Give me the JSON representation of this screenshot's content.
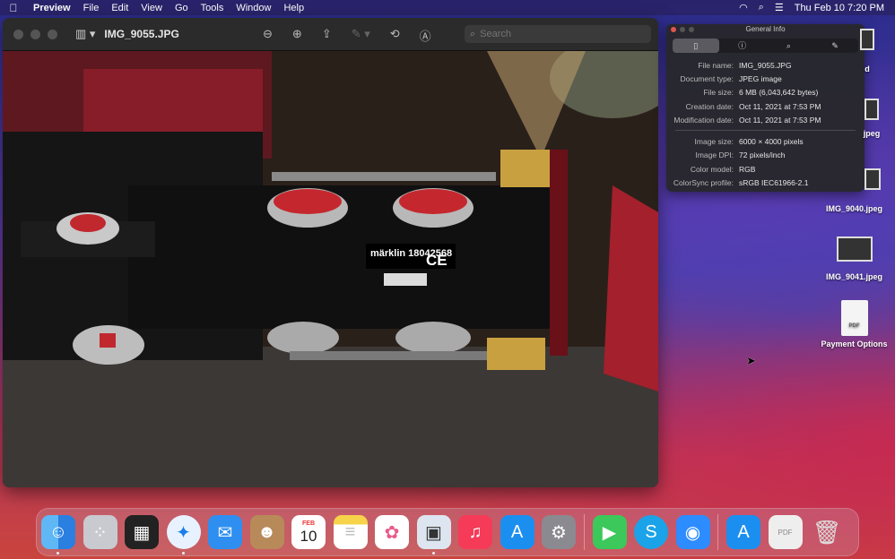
{
  "menubar": {
    "apple": "",
    "app": "Preview",
    "items": [
      "File",
      "Edit",
      "View",
      "Go",
      "Tools",
      "Window",
      "Help"
    ],
    "clock": "Thu Feb 10  7:20 PM"
  },
  "preview": {
    "title": "IMG_9055.JPG",
    "search_placeholder": "Search",
    "photo_label": "märklin 18042568",
    "photo_ce": "CE"
  },
  "info_panel": {
    "title": "General Info",
    "rows": [
      {
        "k": "File name:",
        "v": "IMG_9055.JPG"
      },
      {
        "k": "Document type:",
        "v": "JPEG image"
      },
      {
        "k": "File size:",
        "v": "6 MB (6,043,642 bytes)"
      },
      {
        "k": "Creation date:",
        "v": "Oct 11, 2021 at 7:53 PM"
      },
      {
        "k": "Modification date:",
        "v": "Oct 11, 2021 at 7:53 PM"
      }
    ],
    "rows2": [
      {
        "k": "Image size:",
        "v": "6000 × 4000 pixels"
      },
      {
        "k": "Image DPI:",
        "v": "72 pixels/inch"
      },
      {
        "k": "Color model:",
        "v": "RGB"
      },
      {
        "k": "ColorSync profile:",
        "v": "sRGB IEC61966-2.1"
      }
    ]
  },
  "desktop": {
    "partial_label_1": "d",
    "partial_label_2": "jpeg",
    "icons": [
      "IMG_9040.jpeg",
      "IMG_9041.jpeg",
      "Payment Options"
    ],
    "pdf_tag": "PDF"
  },
  "dock": {
    "calendar_month": "FEB",
    "calendar_day": "10",
    "pdf_tag": "PDF"
  }
}
